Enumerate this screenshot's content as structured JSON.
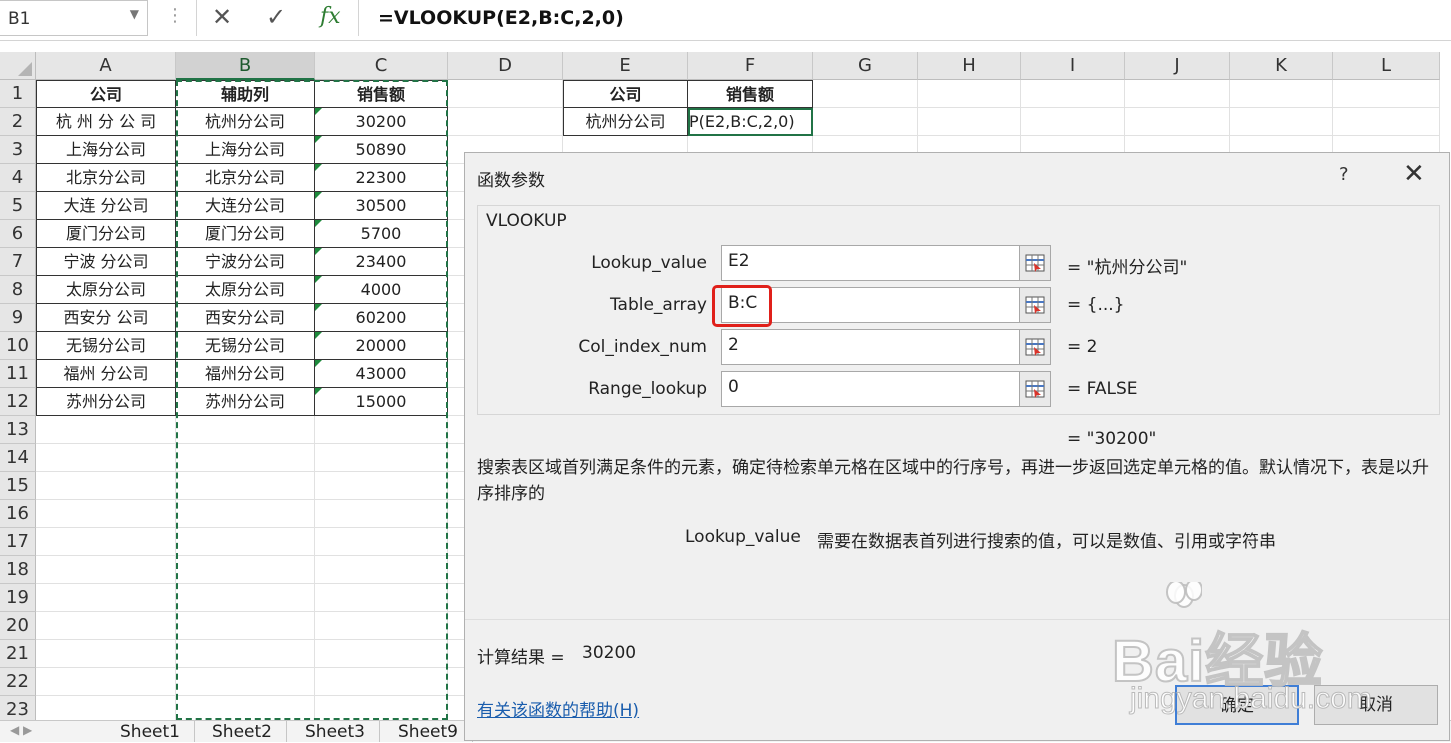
{
  "formula_bar": {
    "name_box": "B1",
    "formula": "=VLOOKUP(E2,B:C,2,0)",
    "cancel_glyph": "✕",
    "enter_glyph": "✓",
    "fx_glyph": "fx"
  },
  "columns": [
    "A",
    "B",
    "C",
    "D",
    "E",
    "F",
    "G",
    "H",
    "I",
    "J",
    "K",
    "L"
  ],
  "rows": [
    "1",
    "2",
    "3",
    "4",
    "5",
    "6",
    "7",
    "8",
    "9",
    "10",
    "11",
    "12",
    "13",
    "14",
    "15",
    "16",
    "17",
    "18",
    "19",
    "20",
    "21",
    "22",
    "23"
  ],
  "table_left": {
    "headers": [
      "公司",
      "辅助列",
      "销售额"
    ],
    "rows": [
      [
        "杭 州 分 公 司",
        "杭州分公司",
        "30200"
      ],
      [
        "上海分公司",
        "上海分公司",
        "50890"
      ],
      [
        "北京分公司",
        "北京分公司",
        "22300"
      ],
      [
        "大连 分公司",
        "大连分公司",
        "30500"
      ],
      [
        "厦门分公司",
        "厦门分公司",
        "5700"
      ],
      [
        "宁波 分公司",
        "宁波分公司",
        "23400"
      ],
      [
        "太原分公司",
        "太原分公司",
        "4000"
      ],
      [
        "西安分 公司",
        "西安分公司",
        "60200"
      ],
      [
        "无锡分公司",
        "无锡分公司",
        "20000"
      ],
      [
        "福州 分公司",
        "福州分公司",
        "43000"
      ],
      [
        "苏州分公司",
        "苏州分公司",
        "15000"
      ]
    ]
  },
  "table_right": {
    "headers": [
      "公司",
      "销售额"
    ],
    "row": [
      "杭州分公司",
      "P(E2,B:C,2,0)"
    ]
  },
  "sheet_tabs": [
    "Sheet1",
    "Sheet2",
    "Sheet3",
    "Sheet9"
  ],
  "dialog": {
    "title": "函数参数",
    "help_glyph": "?",
    "close_glyph": "✕",
    "function_name": "VLOOKUP",
    "args": [
      {
        "label": "Lookup_value",
        "value": "E2",
        "result": "= \"杭州分公司\""
      },
      {
        "label": "Table_array",
        "value": "B:C",
        "result": "= {...}"
      },
      {
        "label": "Col_index_num",
        "value": "2",
        "result": "= 2"
      },
      {
        "label": "Range_lookup",
        "value": "0",
        "result": "= FALSE"
      }
    ],
    "overall_result": "= \"30200\"",
    "description": "搜索表区域首列满足条件的元素，确定待检索单元格在区域中的行序号，再进一步返回选定单元格的值。默认情况下，表是以升序排序的",
    "arg_desc_label": "Lookup_value",
    "arg_desc": "需要在数据表首列进行搜索的值，可以是数值、引用或字符串",
    "calc_label": "计算结果 =",
    "calc_value": "30200",
    "help_link": "有关该函数的帮助(H)",
    "ok": "确定",
    "cancel": "取消"
  },
  "watermark": {
    "brand": "Bai经验",
    "url": "jingyan.baidu.com"
  },
  "colors": {
    "excel_green": "#217346",
    "highlight_red": "#e0201a",
    "link_blue": "#1a5dad"
  }
}
